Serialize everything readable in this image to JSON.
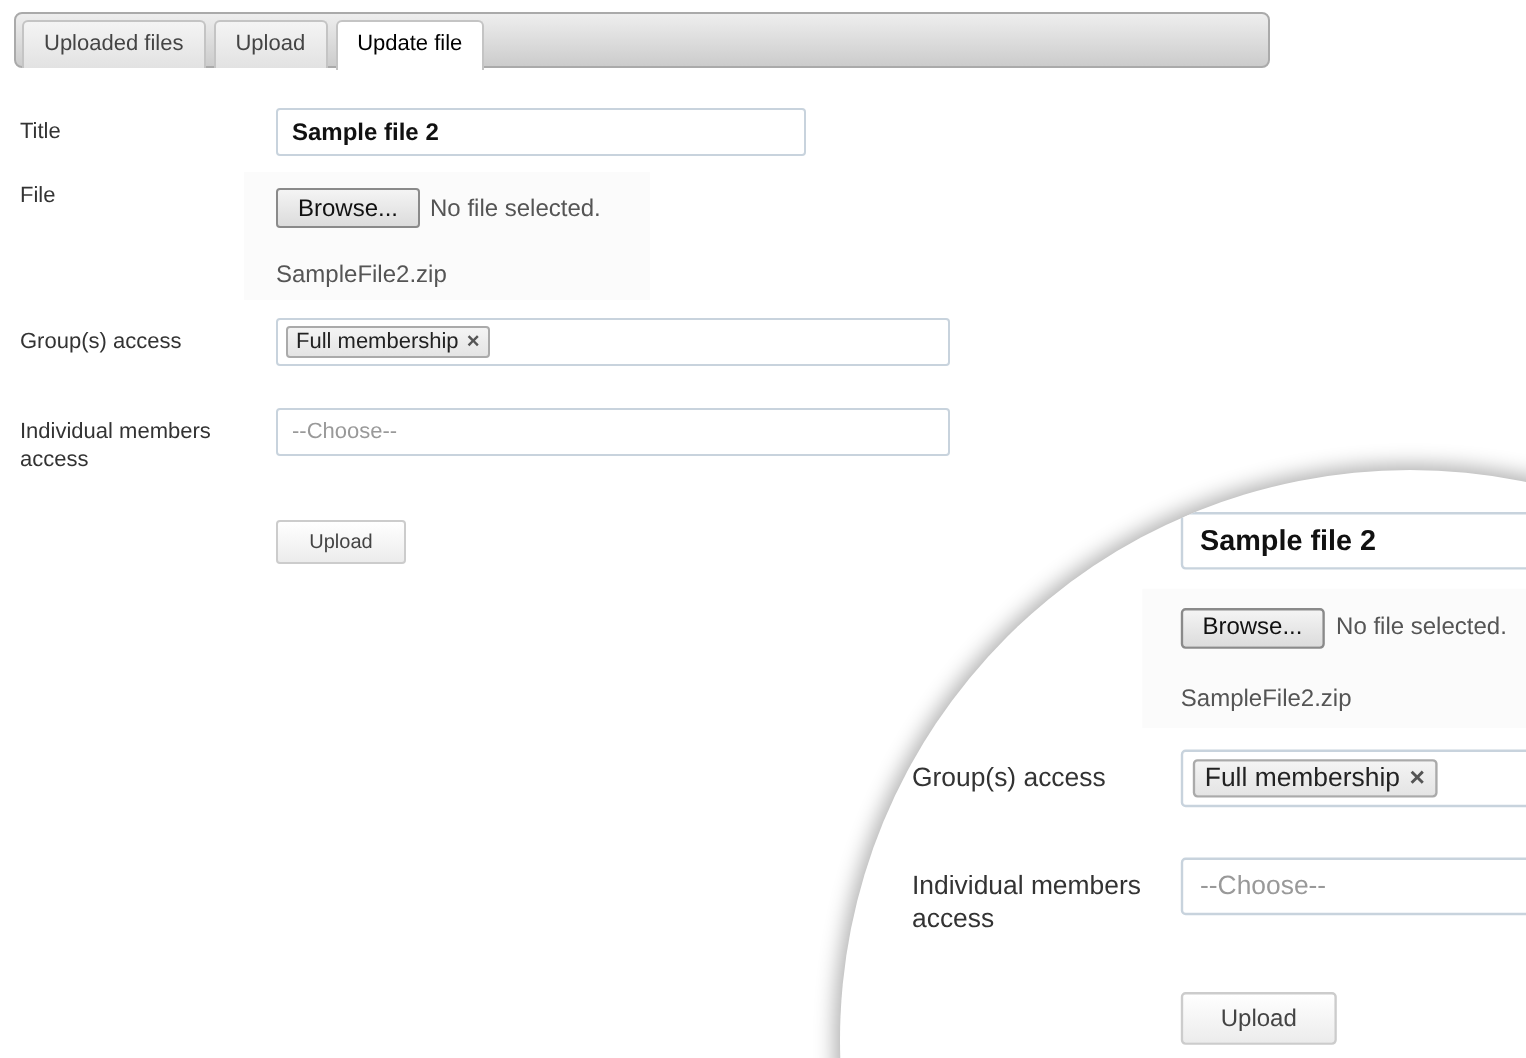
{
  "tabs": [
    {
      "label": "Uploaded files",
      "selected": false
    },
    {
      "label": "Upload",
      "selected": false
    },
    {
      "label": "Update file",
      "selected": true
    }
  ],
  "form": {
    "fields": [
      {
        "kind": "text",
        "label": "Title",
        "value": "Sample file 2"
      },
      {
        "kind": "file",
        "label": "File",
        "button": "Browse...",
        "status": "No file selected.",
        "current": "SampleFile2.zip"
      },
      {
        "kind": "tags",
        "label": "Group(s) access",
        "tags": [
          {
            "text": "Full membership",
            "remove": "×"
          }
        ]
      },
      {
        "kind": "select",
        "label": "Individual members access",
        "placeholder": "--Choose--"
      },
      {
        "kind": "button",
        "label": "Upload"
      }
    ]
  },
  "magnifier": {
    "fields": [
      {
        "kind": "text",
        "value": "Sample file 2"
      },
      {
        "kind": "file",
        "button": "Browse...",
        "status": "No file selected.",
        "current": "SampleFile2.zip"
      },
      {
        "kind": "tags",
        "label": "Group(s) access",
        "tags": [
          {
            "text": "Full membership",
            "remove": "×"
          }
        ]
      },
      {
        "kind": "select",
        "label": "Individual members access",
        "placeholder": "--Choose--"
      },
      {
        "kind": "button",
        "label": "Upload"
      }
    ]
  }
}
